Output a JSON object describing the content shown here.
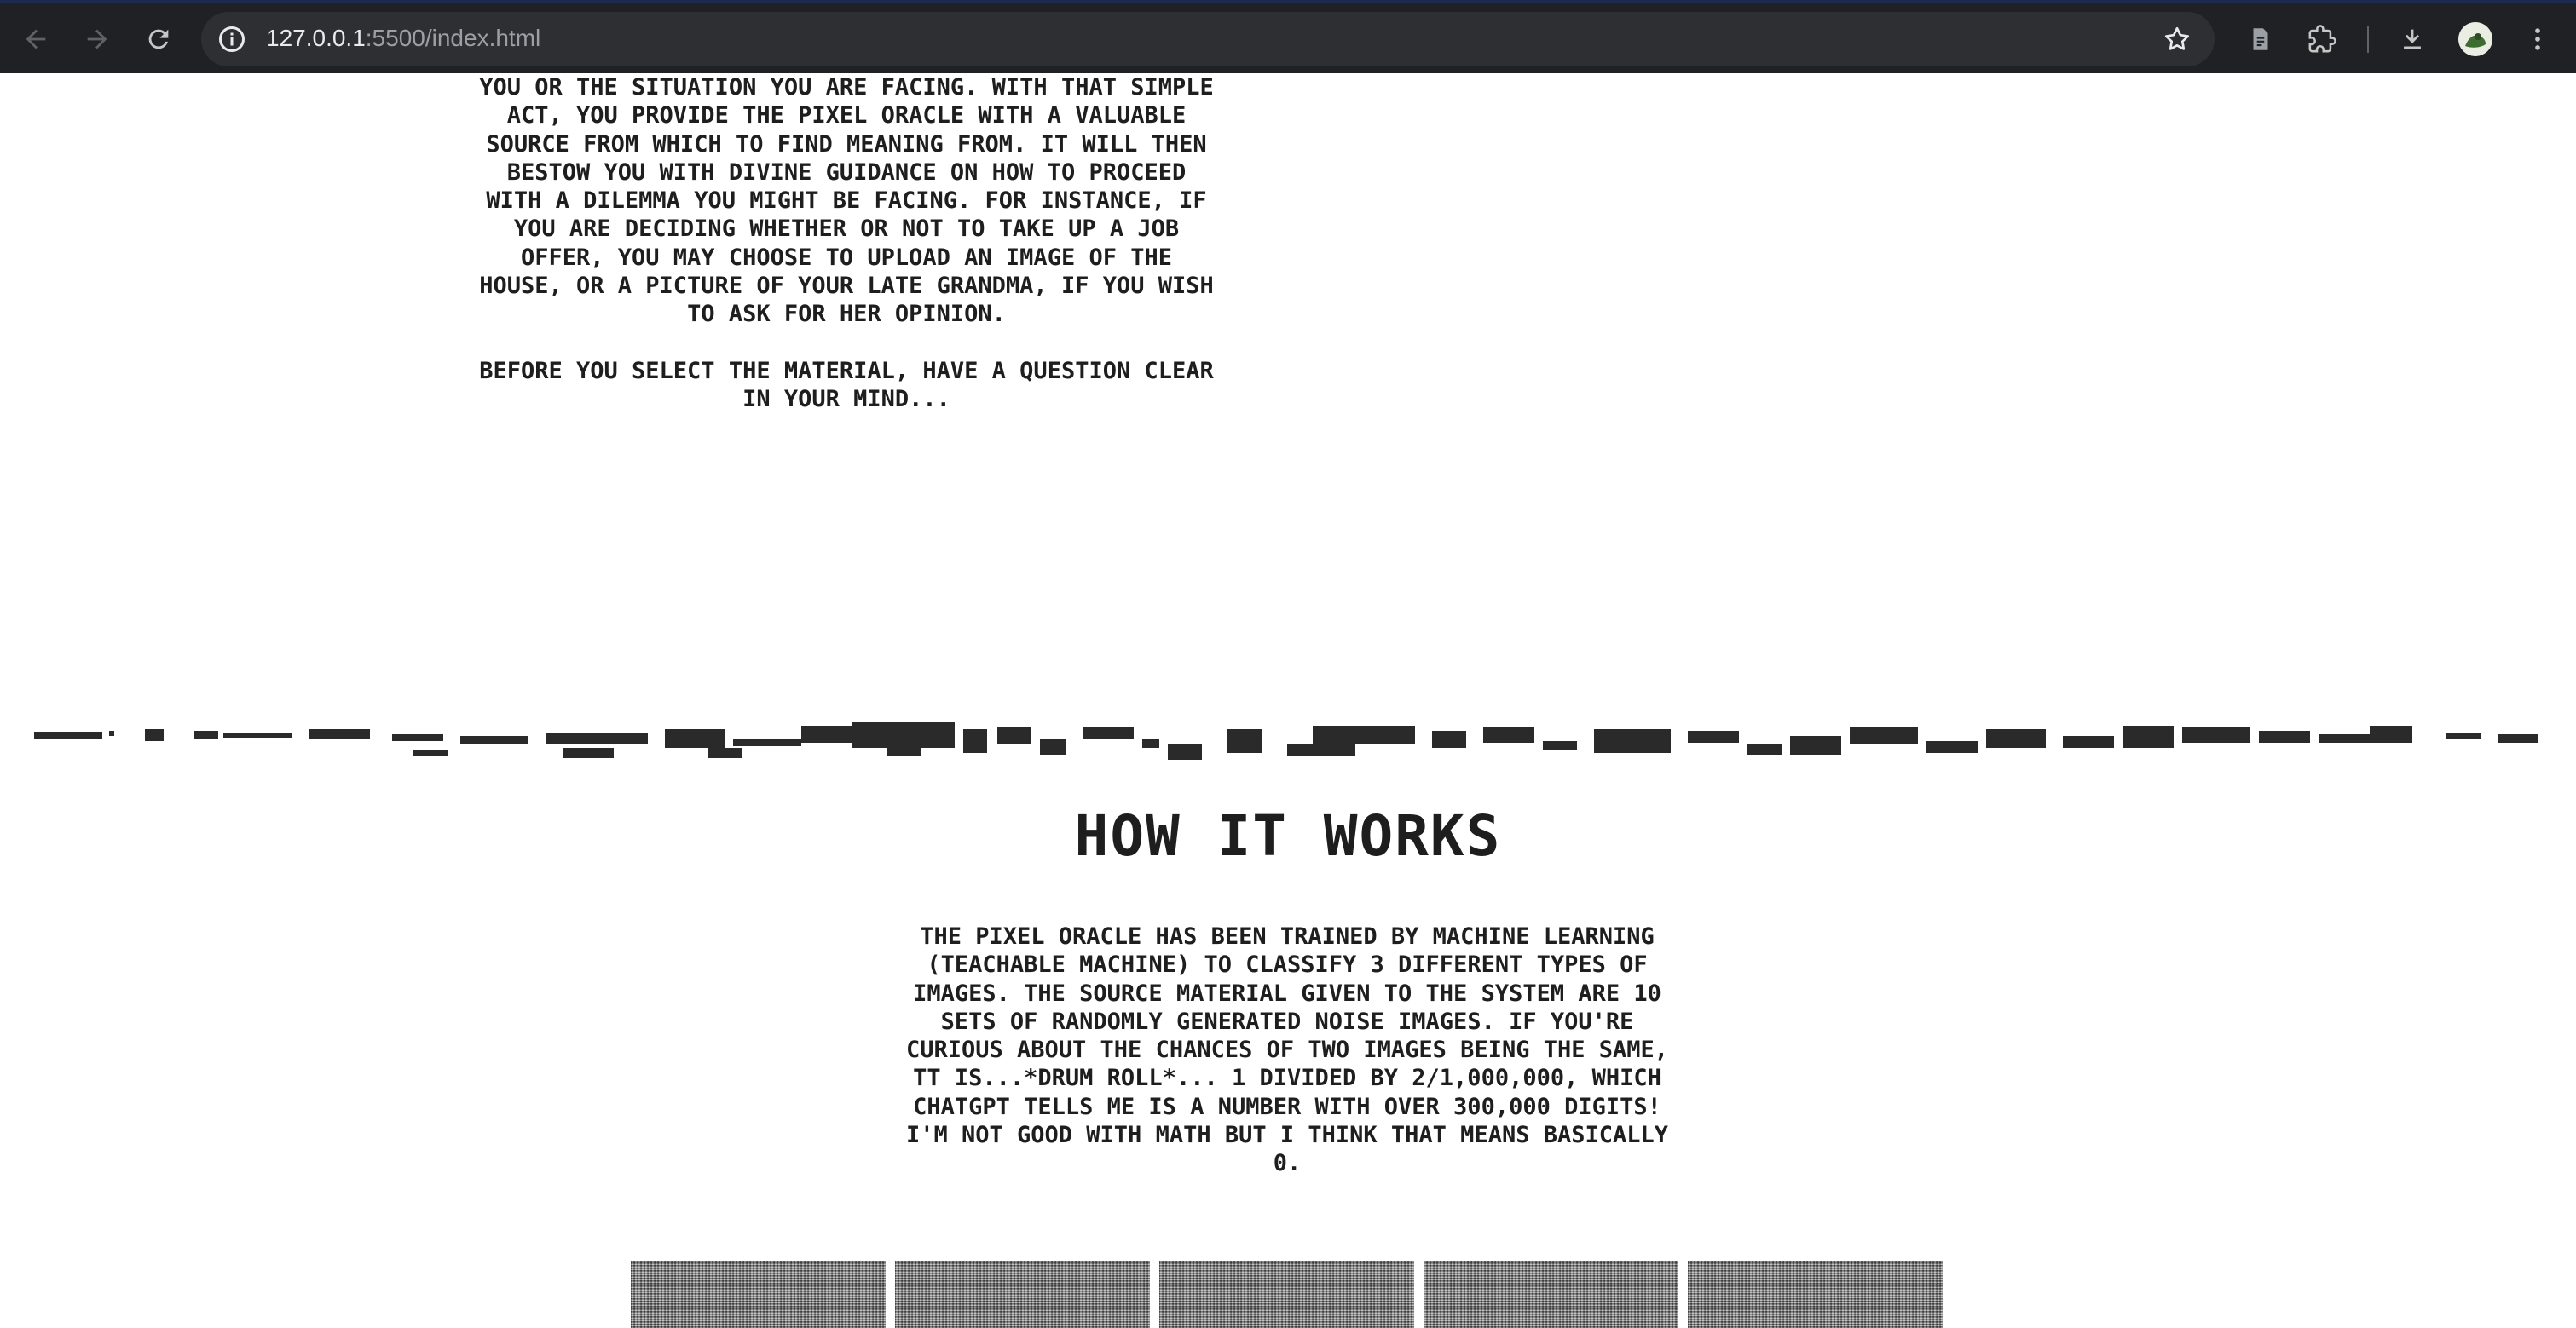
{
  "browser": {
    "url_host": "127.0.0.1",
    "url_rest": ":5500/index.html",
    "icons": [
      "back-arrow-icon",
      "forward-arrow-icon",
      "reload-icon",
      "site-info-icon",
      "bookmark-star-icon",
      "reading-list-icon",
      "extensions-icon",
      "download-icon",
      "profile-avatar",
      "more-menu-icon"
    ]
  },
  "intro": {
    "paragraph": "You or the situation you are facing. With that simple act, you provide the Pixel Oracle with a valuable source from which to find meaning from. It will then bestow you with divine guidance on how to proceed with a dilemma you might be facing. For instance, if you are deciding whether or not to take up a job offer, you may choose to upload an image of the house, or a picture of your late grandma, if you wish to ask for her opinion.",
    "prompt": "Before you select the material, have a question clear in your mind..."
  },
  "how_it_works": {
    "title": "How it works",
    "paragraph": "The Pixel Oracle has been trained by machine learning (Teachable Machine) to classify 3 different types of images. The source material given to the system are 10 sets of randomly generated noise images. If you're curious about the chances of two images being the same, tt is...*drum roll*... 1 divided by 2/1,000,000, which ChatGPT tells me is a number with over 300,000 digits! I'm not good with math but I think that means basically 0."
  },
  "noise_images": [
    "noise-image-1",
    "noise-image-2",
    "noise-image-3",
    "noise-image-4",
    "noise-image-5"
  ],
  "colors": {
    "chrome_bg": "#202124",
    "omnibox_bg": "#2e2f33",
    "text": "#1e1e1e"
  }
}
